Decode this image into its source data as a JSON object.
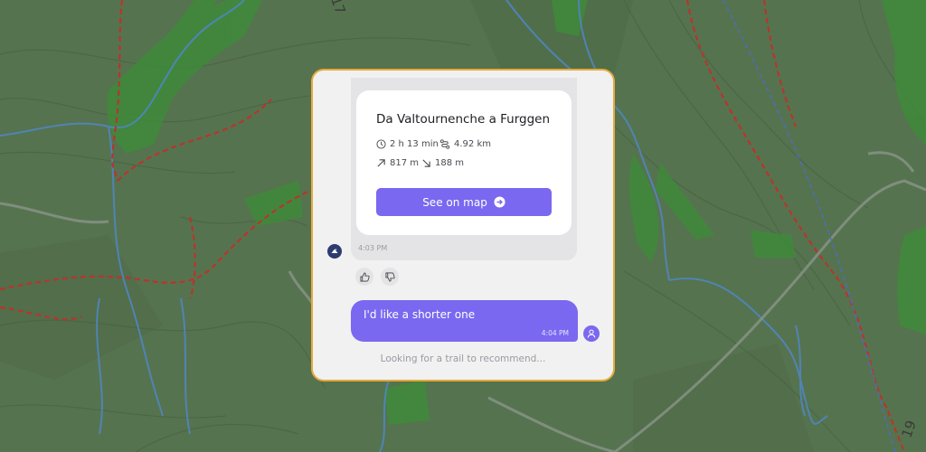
{
  "map": {
    "route_labels": [
      "17",
      "19"
    ]
  },
  "chat": {
    "bot_message": {
      "trail": {
        "name": "Da Valtournenche a Furggen",
        "duration": "2 h 13 min",
        "distance": "4.92 km",
        "ascent": "817 m",
        "descent": "188 m"
      },
      "button_label": "See on map",
      "timestamp": "4:03 PM"
    },
    "user_message": {
      "text": "I'd like a shorter one",
      "timestamp": "4:04 PM"
    },
    "status": "Looking for a trail to recommend..."
  },
  "colors": {
    "accent": "#7a68f0",
    "panel_border": "#e6a93a",
    "map_background": "#56734f",
    "forest": "#3f8a3a",
    "trail_red": "#b8352c",
    "stream_blue": "#4f86c0"
  },
  "icons": {
    "duration": "clock-icon",
    "distance": "route-icon",
    "ascent": "arrow-up-right-icon",
    "descent": "arrow-down-right-icon",
    "button": "arrow-right-circle-icon",
    "like": "thumbs-up-icon",
    "dislike": "thumbs-down-icon",
    "user": "user-icon",
    "bot": "bot-avatar-icon"
  }
}
